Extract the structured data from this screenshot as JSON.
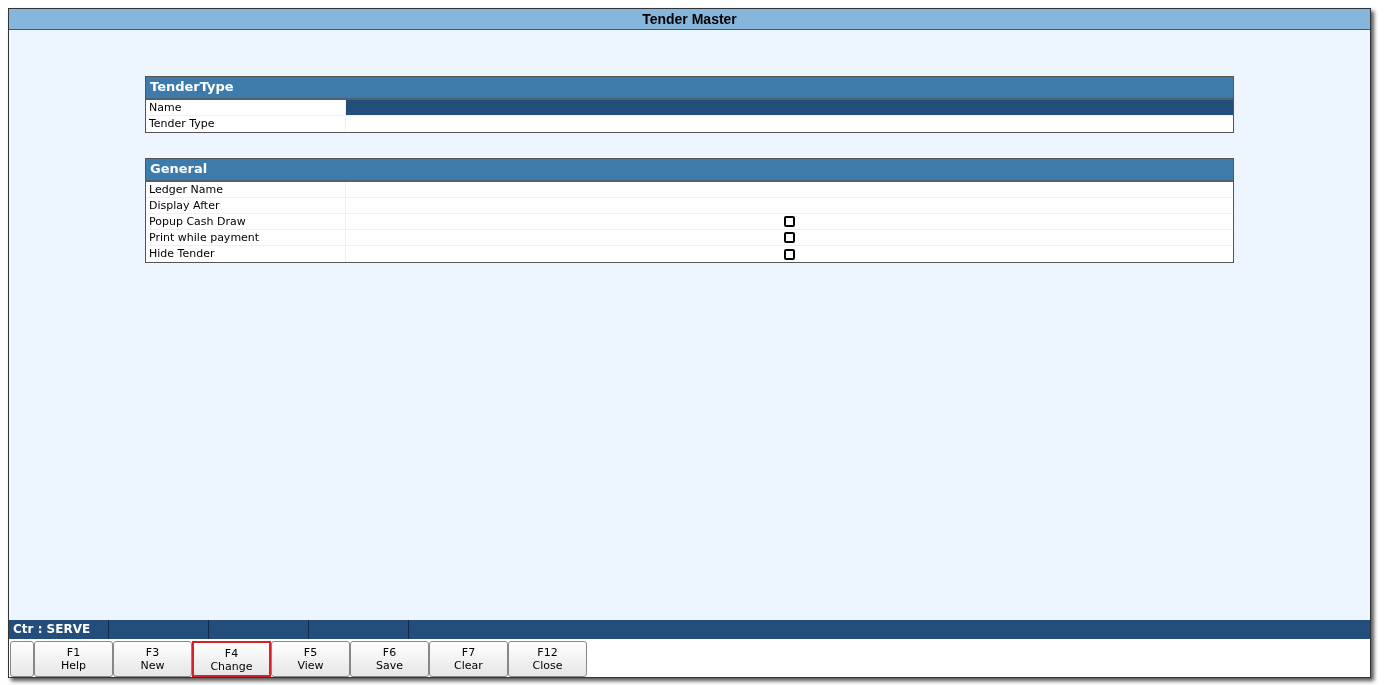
{
  "window": {
    "title": "Tender Master"
  },
  "sections": [
    {
      "title": "TenderType",
      "fields": [
        {
          "label": "Name",
          "kind": "text",
          "selected": true
        },
        {
          "label": "Tender Type",
          "kind": "text",
          "selected": false
        }
      ]
    },
    {
      "title": "General",
      "fields": [
        {
          "label": "Ledger Name",
          "kind": "text",
          "selected": false
        },
        {
          "label": "Display After",
          "kind": "text",
          "selected": false
        },
        {
          "label": "Popup Cash Draw",
          "kind": "checkbox",
          "checked": false,
          "selected": false
        },
        {
          "label": "Print while payment",
          "kind": "checkbox",
          "checked": false,
          "selected": false
        },
        {
          "label": "Hide Tender",
          "kind": "checkbox",
          "checked": false,
          "selected": false
        }
      ]
    }
  ],
  "status_bar": {
    "counter": "Ctr : SERVE"
  },
  "buttons": [
    {
      "key": "F1",
      "label": "Help",
      "selected": false
    },
    {
      "key": "F3",
      "label": "New",
      "selected": false
    },
    {
      "key": "F4",
      "label": "Change",
      "selected": true
    },
    {
      "key": "F5",
      "label": "View",
      "selected": false
    },
    {
      "key": "F6",
      "label": "Save",
      "selected": false
    },
    {
      "key": "F7",
      "label": "Clear",
      "selected": false
    },
    {
      "key": "F12",
      "label": "Close",
      "selected": false
    }
  ]
}
